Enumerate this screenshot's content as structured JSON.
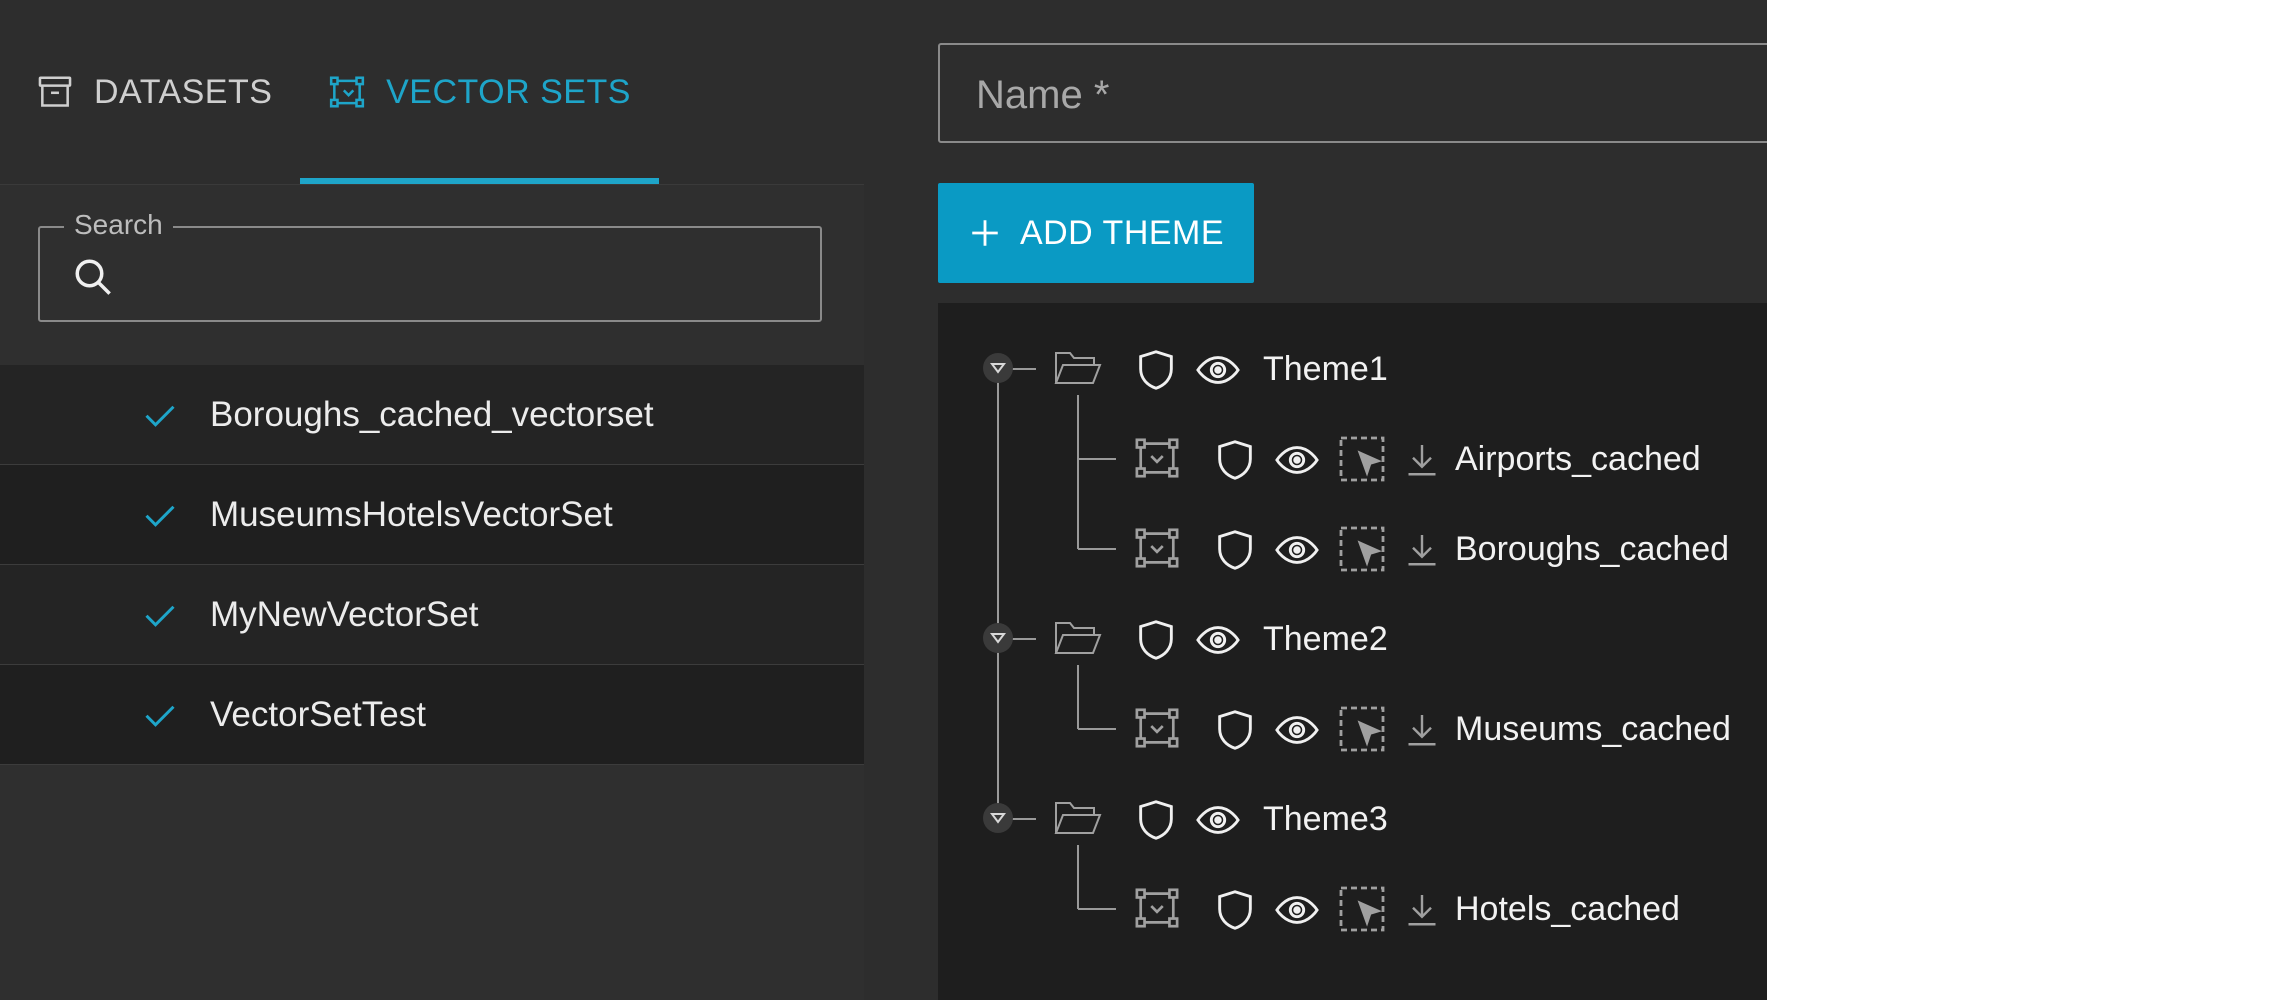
{
  "tabs": [
    {
      "label": "DATASETS",
      "icon": "archive-icon",
      "active": false
    },
    {
      "label": "VECTOR SETS",
      "icon": "vector-set-icon",
      "active": true
    }
  ],
  "search": {
    "legend": "Search",
    "value": "",
    "icon": "search-icon"
  },
  "vector_sets": [
    {
      "label": "Boroughs_cached_vectorset"
    },
    {
      "label": "MuseumsHotelsVectorSet"
    },
    {
      "label": "MyNewVectorSet"
    },
    {
      "label": "VectorSetTest"
    }
  ],
  "name_field": {
    "placeholder": "Name *",
    "value": ""
  },
  "add_theme": {
    "label": "ADD THEME"
  },
  "tree": {
    "themes": [
      {
        "label": "Theme1",
        "layers": [
          {
            "label": "Airports_cached"
          },
          {
            "label": "Boroughs_cached"
          }
        ]
      },
      {
        "label": "Theme2",
        "layers": [
          {
            "label": "Museums_cached"
          }
        ]
      },
      {
        "label": "Theme3",
        "layers": [
          {
            "label": "Hotels_cached"
          }
        ]
      }
    ]
  },
  "colors": {
    "accent": "#1ea5c9",
    "button": "#0a9ac4",
    "panel": "#2d2d2d",
    "tree_bg": "#1e1e1e"
  }
}
